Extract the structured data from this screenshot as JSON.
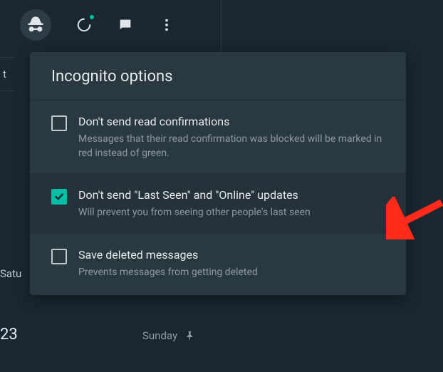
{
  "toolbar": {
    "incognito_icon": "incognito",
    "status_icon": "status",
    "chat_icon": "new-chat",
    "menu_icon": "menu"
  },
  "left": {
    "t": "t",
    "satu": "Satu",
    "date23": "23"
  },
  "panel": {
    "title": "Incognito options",
    "options": [
      {
        "label": "Don't send read confirmations",
        "desc": "Messages that their read confirmation was blocked will be marked in red instead of green.",
        "checked": false
      },
      {
        "label": "Don't send \"Last Seen\" and \"Online\" updates",
        "desc": "Will prevent you from seeing other people's last seen",
        "checked": true
      },
      {
        "label": "Save deleted messages",
        "desc": "Prevents messages from getting deleted",
        "checked": false
      }
    ]
  },
  "bottom": {
    "sunday": "Sunday"
  }
}
